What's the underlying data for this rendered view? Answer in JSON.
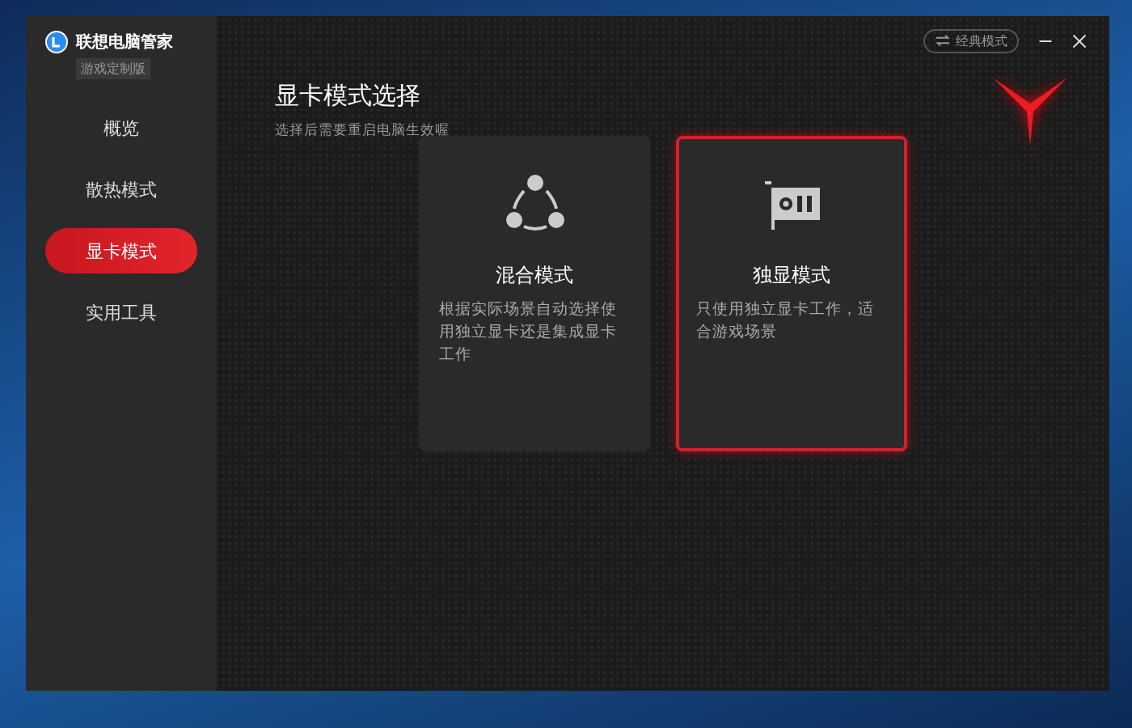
{
  "window": {
    "app_name": "联想电脑管家",
    "edition_badge": "游戏定制版"
  },
  "sidebar": {
    "items": [
      {
        "label": "概览",
        "selected": false
      },
      {
        "label": "散热模式",
        "selected": false
      },
      {
        "label": "显卡模式",
        "selected": true
      },
      {
        "label": "实用工具",
        "selected": false
      }
    ]
  },
  "top_bar": {
    "classic_mode_button": "经典模式"
  },
  "page": {
    "title": "显卡模式选择",
    "subtitle": "选择后需要重启电脑生效喔"
  },
  "modes": [
    {
      "kind": "hybrid",
      "title": "混合模式",
      "description": "根据实际场景自动选择使用独立显卡还是集成显卡工作",
      "selected": false
    },
    {
      "kind": "discrete",
      "title": "独显模式",
      "description": "只使用独立显卡工作，适合游戏场景",
      "selected": true
    }
  ]
}
